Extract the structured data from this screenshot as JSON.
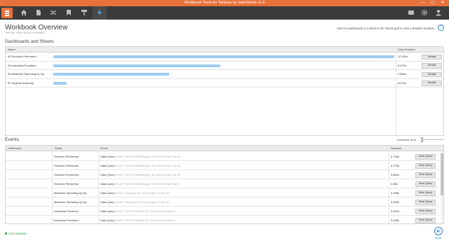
{
  "window": {
    "title": "Workbook Tools for Tableau by InterWorks v1.6",
    "controls": [
      "—",
      "▢",
      "✕"
    ]
  },
  "toolbar": {
    "buttons": [
      {
        "name": "home-icon"
      },
      {
        "name": "document-icon"
      },
      {
        "name": "shuffle-icon"
      },
      {
        "name": "bookmark-icon"
      },
      {
        "name": "paint-roller-icon"
      },
      {
        "name": "lightning-icon",
        "active": true
      }
    ],
    "right": [
      {
        "name": "chat-icon"
      },
      {
        "name": "gear-icon"
      },
      {
        "name": "user-icon"
      }
    ],
    "accent": "#e8723c",
    "active_color": "#4ab0ff"
  },
  "page": {
    "title": "Workbook Overview",
    "subtitle": "Test Bar Data Source Prestgers",
    "hint": "Select a dashboard or a sheet in the sheets grid to view a detailed analysis.",
    "help": "?"
  },
  "dashboards": {
    "section_title": "Dashboards and Sheets",
    "columns": {
      "name": "Name",
      "duration": "View Duration"
    },
    "button_label": "Details",
    "rows": [
      {
        "name": "00 Services Performed",
        "duration": "12.454s",
        "fraction": 1.0
      },
      {
        "name": "00 Individual Providers",
        "duration": "6.573s",
        "fraction": 0.49
      },
      {
        "name": "00 Medicare Spending by Zip",
        "duration": "4.884s",
        "fraction": 0.34
      },
      {
        "name": "00 Virginia Summary",
        "duration": "527ms",
        "fraction": 0.04
      }
    ]
  },
  "events": {
    "section_title": "Events",
    "threshold_label": "Threshold: 0ms",
    "columns": {
      "dashboard": "Dashboard",
      "sheet": "Sheet",
      "event": "Event",
      "duration": "Duration"
    },
    "button_label": "View Query",
    "rows": [
      {
        "dashboard": "",
        "sheet": "Services Performed",
        "event": "Data Query",
        "detail": "SELECT \"IDVSPDLUBWAPI(copy)\" AS \"[none]:Provider Type':nk\"...",
        "duration": "6.733s"
      },
      {
        "dashboard": "",
        "sheet": "Services Performed",
        "event": "Data Query",
        "detail": "SELECT \"IDVSPDLUBWAPI(copy)\" AS \"[none]:Provider Type':nk\"...",
        "duration": "6.719s"
      },
      {
        "dashboard": "",
        "sheet": "Services Performed",
        "event": "Data Query",
        "detail": "SELECT \"IDVSPDLUBWAPI(copy)\" AS \"[none]:Provider Type':nk\"...",
        "duration": "4.883s"
      },
      {
        "dashboard": "",
        "sheet": "Services Performed",
        "event": "Data Query",
        "detail": "SELECT \"IDVSPDLUBWAPI(copy)\" AS \"[none]:Provider Type':nk\"...",
        "duration": "4.88s"
      },
      {
        "dashboard": "",
        "sheet": "Medicare Spending by Zip",
        "event": "Data Query",
        "detail": "SELECT \"Geography\" AS \"[none]:Region Provider':nk\"...",
        "duration": "3.298s"
      },
      {
        "dashboard": "",
        "sheet": "Medicare Spending by Zip",
        "event": "Data Query",
        "detail": "SELECT \"Geography\" AS \"[none]:Region Provider':nk\"...",
        "duration": "3.293s"
      },
      {
        "dashboard": "",
        "sheet": "Individual Providers",
        "event": "Data Query",
        "detail": "SELECT \"IDVSPDLUBWAPI\" AS \"[none]:Provider Name':nk\"...",
        "duration": "3.202s"
      },
      {
        "dashboard": "",
        "sheet": "Individual Providers",
        "event": "Data Query",
        "detail": "SELECT \"IDVSPDLUBWAPI\" AS \"[none]:Provider Name':nk\"...",
        "duration": "3.198s"
      }
    ]
  },
  "footer": {
    "live_label": "Live Session",
    "back_label": "Back"
  }
}
